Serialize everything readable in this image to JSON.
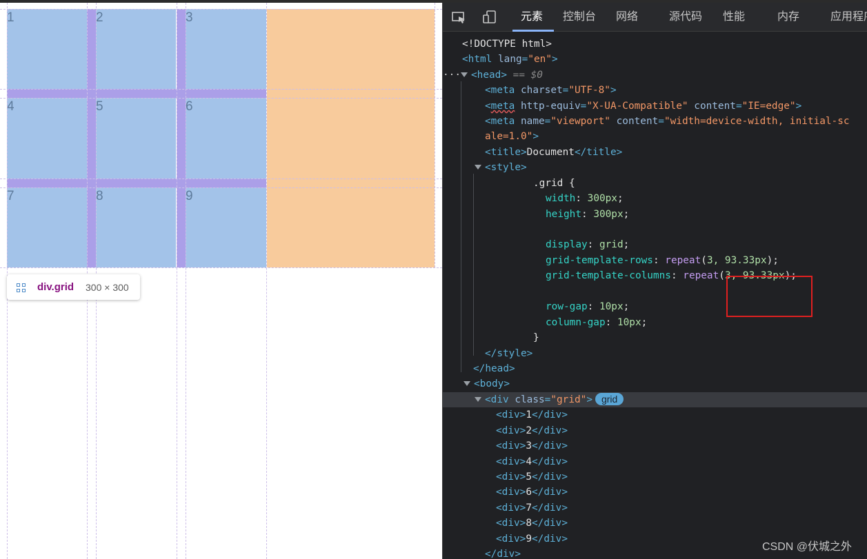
{
  "viewport": {
    "cells": [
      "1",
      "2",
      "3",
      "4",
      "5",
      "6",
      "7",
      "8",
      "9"
    ],
    "tooltip": {
      "selector": "div.grid",
      "size": "300 × 300"
    }
  },
  "devtools": {
    "tabs": [
      "元素",
      "控制台",
      "网络",
      "源代码",
      "性能",
      "内存",
      "应用程序"
    ],
    "active_tab": "元素",
    "code": {
      "doctype": "<!DOCTYPE html>",
      "html_open": {
        "tag": "html",
        "attr": "lang",
        "value": "\"en\""
      },
      "head": {
        "tag": "head",
        "marker": "== $0"
      },
      "meta1": {
        "attr": "charset",
        "value": "\"UTF-8\""
      },
      "meta2": {
        "attr1": "http-equiv",
        "value1": "\"X-UA-Compatible\"",
        "attr2": "content",
        "value2": "\"IE=edge\""
      },
      "meta3": {
        "attr1": "name",
        "value1": "\"viewport\"",
        "attr2": "content",
        "value2a": "\"width=device-width, initial-sc",
        "value2b": "ale=1.0\""
      },
      "title": "Document",
      "css": {
        "selector": ".grid {",
        "width": {
          "prop": "width",
          "value": "300px"
        },
        "height": {
          "prop": "height",
          "value": "300px"
        },
        "display": {
          "prop": "display",
          "value": "grid"
        },
        "rows": {
          "prop": "grid-template-rows",
          "fn": "repeat",
          "args": "3, 93.33px"
        },
        "cols": {
          "prop": "grid-template-columns",
          "fn": "repeat",
          "args": "3, 93.33px"
        },
        "row_gap": {
          "prop": "row-gap",
          "value": "10px"
        },
        "col_gap": {
          "prop": "column-gap",
          "value": "10px"
        },
        "close": "}"
      },
      "grid_div": {
        "attr": "class",
        "value": "\"grid\"",
        "badge": "grid"
      },
      "children": [
        "1",
        "2",
        "3",
        "4",
        "5",
        "6",
        "7",
        "8",
        "9"
      ]
    }
  },
  "watermark": "CSDN @伏城之外",
  "colors": {
    "cell": "#a3c3e9",
    "gap": "#ab9fe8",
    "overflow": "#f8cb9c",
    "highlight_box": "#e02020"
  }
}
